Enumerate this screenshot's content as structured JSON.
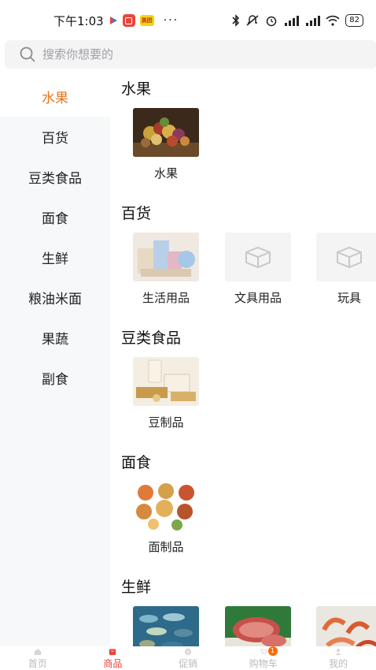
{
  "status_bar": {
    "time": "下午1:03",
    "app_badge": "美团",
    "dots": "···",
    "battery": "82",
    "icons": [
      "play-icon",
      "red-app-icon",
      "meituan-icon",
      "bluetooth-icon",
      "mute-icon",
      "alarm-icon",
      "signal-icon",
      "signal-icon",
      "wifi-icon",
      "battery-icon"
    ]
  },
  "search": {
    "placeholder": "搜索你想要的"
  },
  "sidebar": {
    "categories": [
      {
        "label": "水果",
        "active": true
      },
      {
        "label": "百货",
        "active": false
      },
      {
        "label": "豆类食品",
        "active": false
      },
      {
        "label": "面食",
        "active": false
      },
      {
        "label": "生鲜",
        "active": false
      },
      {
        "label": "粮油米面",
        "active": false
      },
      {
        "label": "果蔬",
        "active": false
      },
      {
        "label": "副食",
        "active": false
      }
    ]
  },
  "sections": [
    {
      "title": "水果",
      "items": [
        {
          "label": "水果",
          "image": "fruit-basket"
        }
      ]
    },
    {
      "title": "百货",
      "items": [
        {
          "label": "生活用品",
          "image": "household-goods"
        },
        {
          "label": "文具用品",
          "image": "placeholder-box"
        },
        {
          "label": "玩具",
          "image": "placeholder-box"
        }
      ]
    },
    {
      "title": "豆类食品",
      "items": [
        {
          "label": "豆制品",
          "image": "soy-products"
        }
      ]
    },
    {
      "title": "面食",
      "items": [
        {
          "label": "面制品",
          "image": "pasta-dishes"
        }
      ]
    },
    {
      "title": "生鲜",
      "items": [
        {
          "label": "",
          "image": "seafood-assortment"
        },
        {
          "label": "",
          "image": "sliced-ham"
        },
        {
          "label": "",
          "image": "shrimp"
        }
      ]
    }
  ],
  "tabbar": {
    "tabs": [
      {
        "label": "首页",
        "icon": "home-icon",
        "active": false
      },
      {
        "label": "商品",
        "icon": "shopping-bag-icon",
        "active": true
      },
      {
        "label": "促销",
        "icon": "promo-icon",
        "active": false
      },
      {
        "label": "购物车",
        "icon": "cart-icon",
        "active": false,
        "badge": "1"
      },
      {
        "label": "我的",
        "icon": "user-icon",
        "active": false
      }
    ]
  },
  "colors": {
    "accent": "#e8731e",
    "brand_red": "#e8453c",
    "sidebar_bg": "#f7f8fa"
  }
}
